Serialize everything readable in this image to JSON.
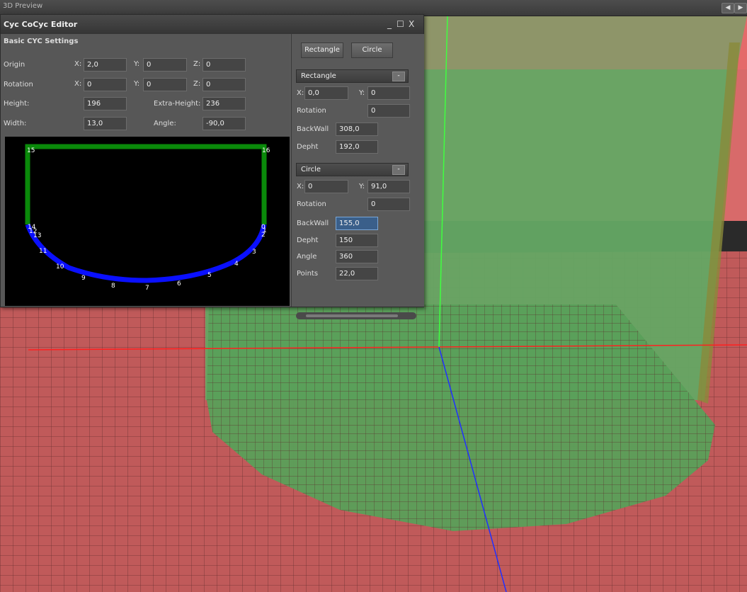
{
  "outer_window": {
    "title": "3D Preview"
  },
  "editor": {
    "title": "Cyc CoCyc Editor",
    "window_controls": {
      "minimize": "_",
      "maximize": "☐",
      "close": "X"
    },
    "basic_settings": {
      "heading": "Basic CYC Settings",
      "origin": {
        "label": "Origin",
        "x_label": "X:",
        "x": "2,0",
        "y_label": "Y:",
        "y": "0",
        "z_label": "Z:",
        "z": "0"
      },
      "rotation": {
        "label": "Rotation",
        "x_label": "X:",
        "x": "0",
        "y_label": "Y:",
        "y": "0",
        "z_label": "Z:",
        "z": "0"
      },
      "height": {
        "label": "Height:",
        "value": "196"
      },
      "extra_height": {
        "label": "Extra-Height:",
        "value": "236"
      },
      "width": {
        "label": "Width:",
        "value": "13,0"
      },
      "angle": {
        "label": "Angle:",
        "value": "-90,0"
      }
    },
    "curve_points": [
      "15",
      "16",
      "14",
      "12",
      "13",
      "0",
      "1",
      "2",
      "3",
      "4",
      "5",
      "6",
      "7",
      "8",
      "9",
      "10",
      "11"
    ],
    "add_rectangle_button": "Rectangle",
    "add_circle_button": "Circle",
    "rectangle_section": {
      "title": "Rectangle",
      "collapse": "-",
      "x_label": "X:",
      "x": "0,0",
      "y_label": "Y:",
      "y": "0",
      "rotation_label": "Rotation",
      "rotation": "0",
      "backwall_label": "BackWall",
      "backwall": "308,0",
      "depth_label": "Depht",
      "depth": "192,0"
    },
    "circle_section": {
      "title": "Circle",
      "collapse": "-",
      "x_label": "X:",
      "x": "0",
      "y_label": "Y:",
      "y": "91,0",
      "rotation_label": "Rotation",
      "rotation": "0",
      "backwall_label": "BackWall",
      "backwall": "155,0",
      "depth_label": "Depht",
      "depth": "150",
      "angle_label": "Angle",
      "angle": "360",
      "points_label": "Points",
      "points": "22,0"
    }
  },
  "colors": {
    "wall": "#e06060",
    "floor_area": "#5aa05a",
    "axis_x": "#ff2020",
    "axis_y": "#2030ff",
    "axis_z": "#40ff40"
  }
}
